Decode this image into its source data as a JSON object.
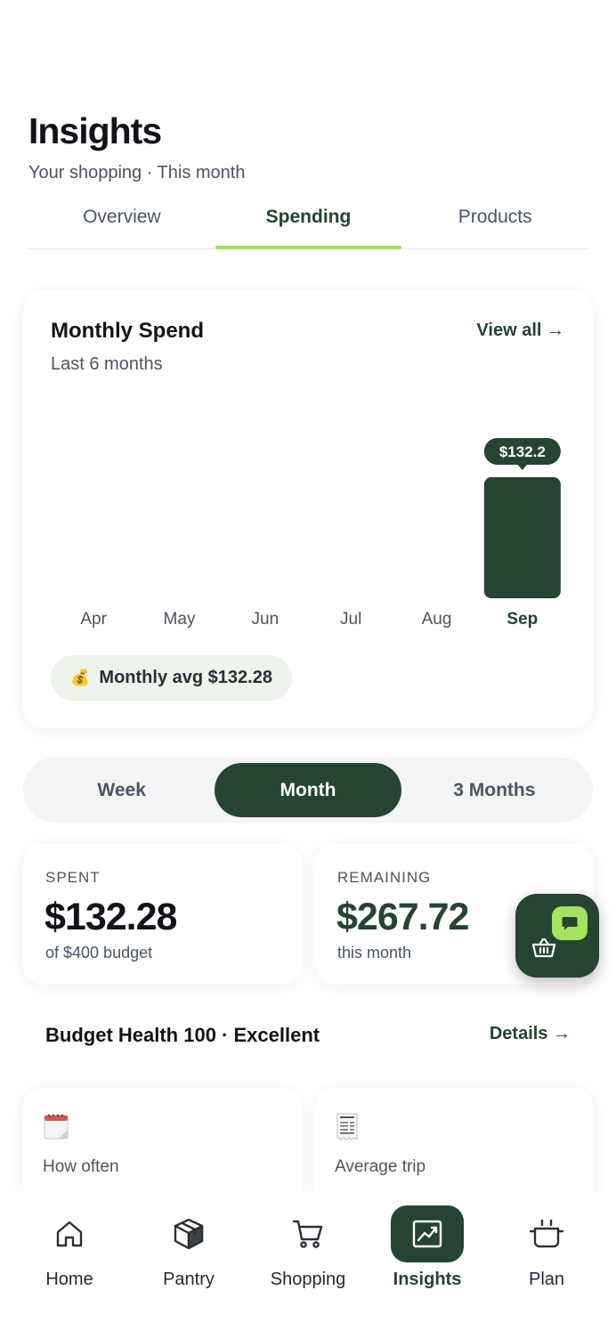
{
  "header": {
    "title": "Insights",
    "subtitle": "Your shopping · This month"
  },
  "tabs": [
    {
      "label": "Overview",
      "active": false
    },
    {
      "label": "Spending",
      "active": true
    },
    {
      "label": "Products",
      "active": false
    }
  ],
  "spend_card": {
    "title": "Monthly Spend",
    "subtitle": "Last 6 months",
    "view_all": "View all →",
    "avg_label": "Monthly avg $132.28",
    "avg_icon": "money-bag-icon"
  },
  "chart_data": {
    "type": "bar",
    "categories": [
      "Apr",
      "May",
      "Jun",
      "Jul",
      "Aug",
      "Sep"
    ],
    "values": [
      0,
      0,
      0,
      0,
      0,
      132.28
    ],
    "highlight_index": 5,
    "tooltip": "$132.2",
    "bar_color": "#254431",
    "ylim": [
      0,
      132.28
    ]
  },
  "period_selector": {
    "options": [
      "Week",
      "Month",
      "3 Months"
    ],
    "selected": "Month"
  },
  "stats": {
    "spent": {
      "label": "SPENT",
      "value": "$132.28",
      "note": "of $400 budget"
    },
    "remaining": {
      "label": "REMAINING",
      "value": "$267.72",
      "note": "this month"
    }
  },
  "budget_health": {
    "title": "Budget Health 100 · Excellent",
    "link": "Details →"
  },
  "mini_cards": [
    {
      "label": "How often",
      "icon": "calendar-icon"
    },
    {
      "label": "Average trip",
      "icon": "receipt-icon"
    }
  ],
  "nav": [
    {
      "label": "Home",
      "icon": "home-icon",
      "active": false
    },
    {
      "label": "Pantry",
      "icon": "box-icon",
      "active": false
    },
    {
      "label": "Shopping",
      "icon": "cart-icon",
      "active": false
    },
    {
      "label": "Insights",
      "icon": "chart-icon",
      "active": true
    },
    {
      "label": "Plan",
      "icon": "pot-icon",
      "active": false
    }
  ],
  "colors": {
    "primary": "#254431",
    "accent": "#9ae05a",
    "fab_chat": "#a3e35e"
  }
}
